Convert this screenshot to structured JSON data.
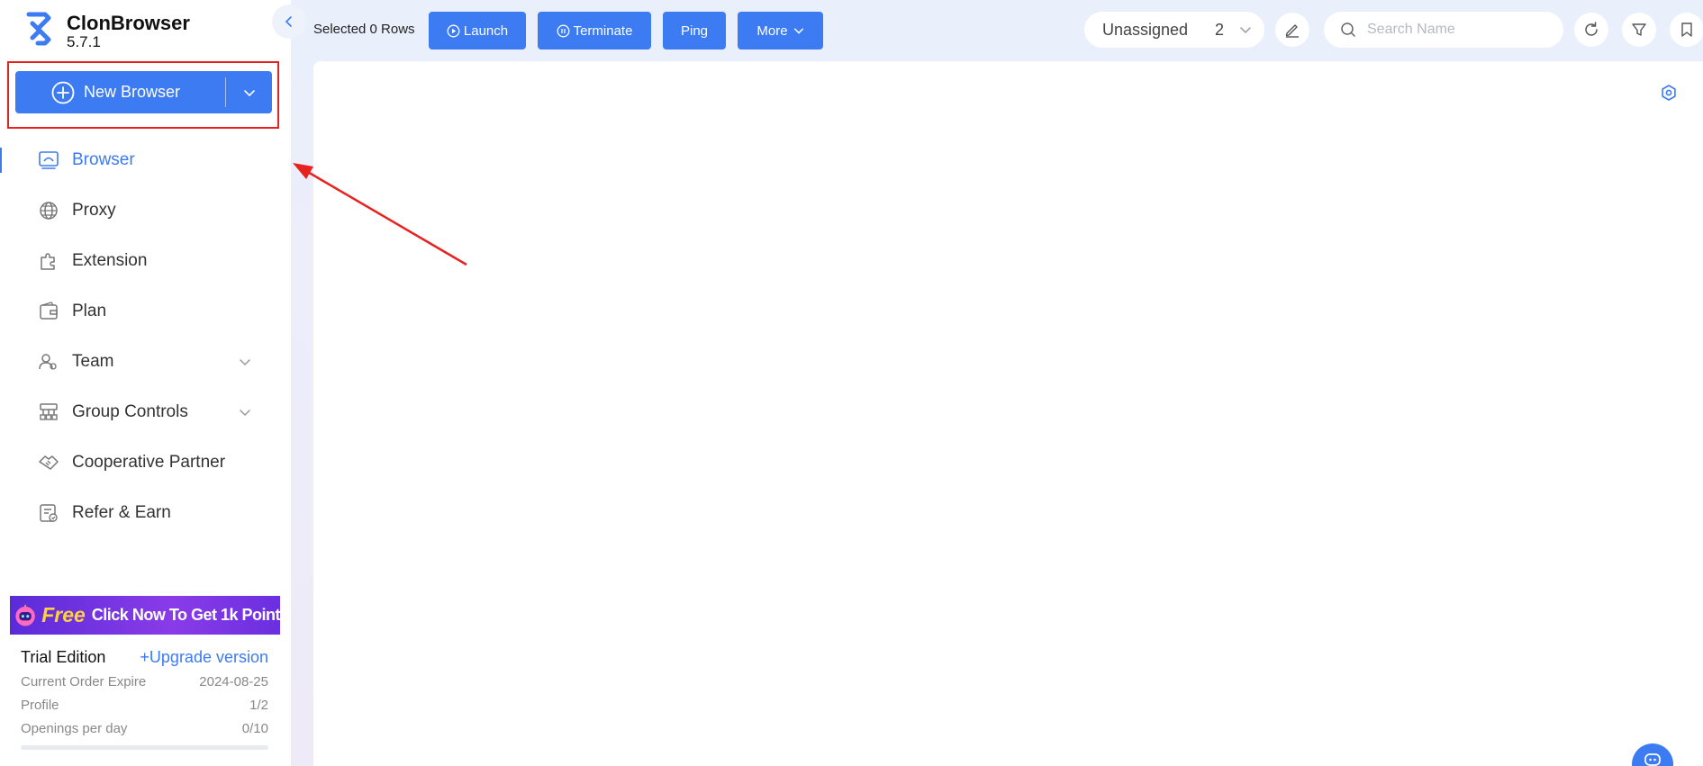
{
  "app": {
    "name": "ClonBrowser",
    "version": "5.7.1"
  },
  "primary_action": {
    "label": "New Browser"
  },
  "nav": [
    {
      "label": "Browser",
      "icon": "browser-icon",
      "active": true
    },
    {
      "label": "Proxy",
      "icon": "proxy-globe-icon"
    },
    {
      "label": "Extension",
      "icon": "extension-puzzle-icon"
    },
    {
      "label": "Plan",
      "icon": "plan-wallet-icon"
    },
    {
      "label": "Team",
      "icon": "team-icon",
      "expandable": true
    },
    {
      "label": "Group Controls",
      "icon": "group-controls-icon",
      "expandable": true
    },
    {
      "label": "Cooperative Partner",
      "icon": "handshake-icon"
    },
    {
      "label": "Refer & Earn",
      "icon": "refer-earn-icon"
    }
  ],
  "promo": {
    "free": "Free",
    "text": "Click Now To Get 1k Point"
  },
  "plan_info": {
    "title": "Trial Edition",
    "upgrade": "+Upgrade version",
    "rows": [
      {
        "label": "Current Order Expire",
        "value": "2024-08-25"
      },
      {
        "label": "Profile",
        "value": "1/2"
      },
      {
        "label": "Openings per day",
        "value": "0/10"
      }
    ],
    "openings_progress": 0
  },
  "toolbar": {
    "selected_rows": "Selected 0 Rows",
    "launch": "Launch",
    "terminate": "Terminate",
    "ping": "Ping",
    "more": "More",
    "group": "Unassigned",
    "group_count": "2",
    "search_placeholder": "Search Name"
  },
  "colors": {
    "accent": "#3d7bf2",
    "annotation": "#e8221f",
    "promo_free": "#ffd23a"
  }
}
